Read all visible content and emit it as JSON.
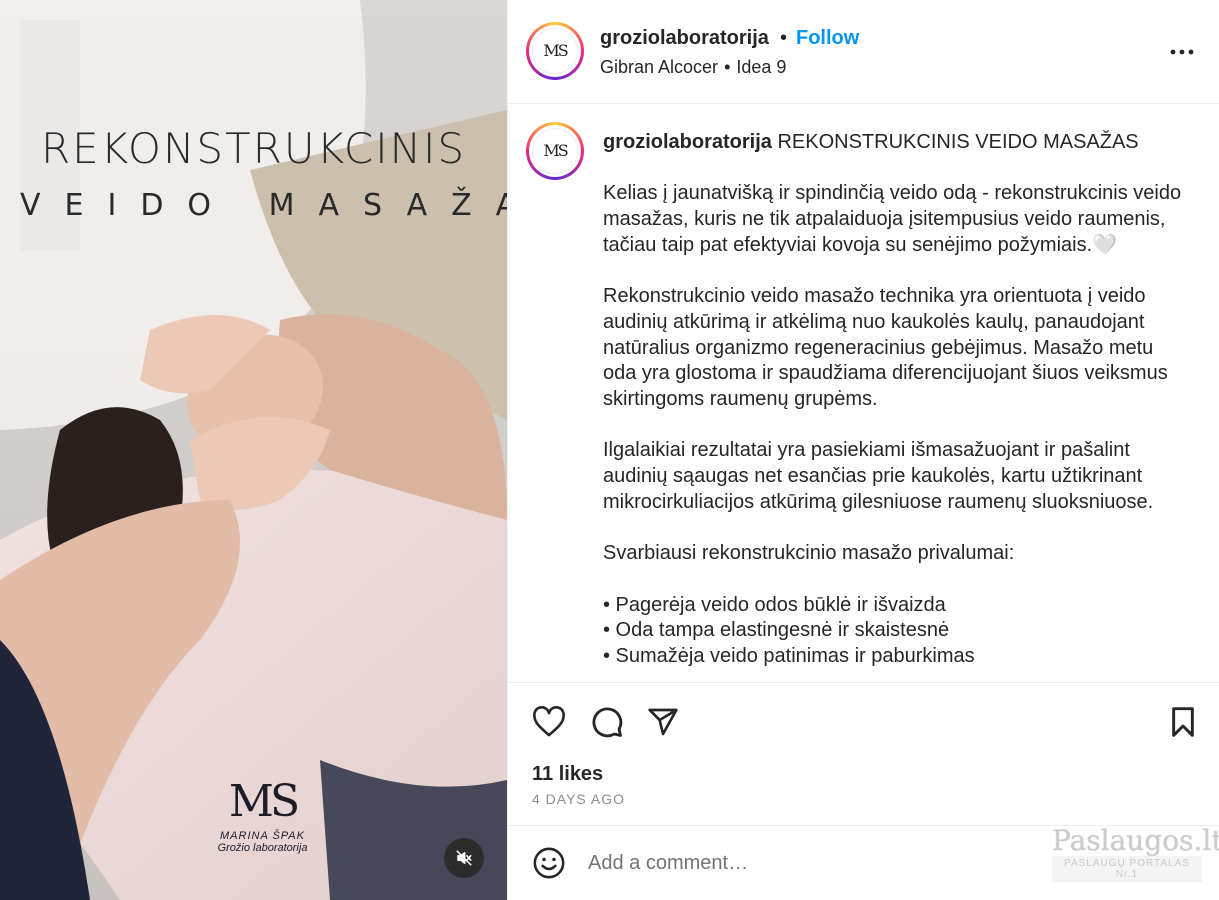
{
  "media": {
    "title_line1": "REKONSTRUKCINIS",
    "title_line2": "VEIDO MASAŽAS",
    "logo_mark": "MS",
    "logo_name": "MARINA ŠPAK",
    "logo_sub": "Grožio laboratorija"
  },
  "header": {
    "username": "groziolaboratorija",
    "dot": "•",
    "follow_label": "Follow",
    "audio_artist": "Gibran Alcocer",
    "audio_sep": "•",
    "audio_track": "Idea 9"
  },
  "caption": {
    "username": "groziolaboratorija",
    "headline": "REKONSTRUKCINIS VEIDO MASAŽAS",
    "paragraphs": [
      "Kelias į jaunatvišką ir spindinčią veido odą - rekonstrukcinis veido masažas, kuris ne tik atpalaiduoja įsitempusius veido raumenis, tačiau taip pat efektyviai kovoja su senėjimo požymiais.🤍",
      "Rekonstrukcinio veido masažo technika yra orientuota į veido audinių atkūrimą ir atkėlimą nuo kaukolės kaulų, panaudojant natūralius organizmo regeneracinius gebėjimus. Masažo metu oda yra glostoma ir spaudžiama diferencijuojant šiuos veiksmus skirtingoms raumenų grupėms.",
      "Ilgalaikiai rezultatai yra pasiekiami išmasažuojant ir pašalint audinių sąaugas net esančias prie kaukolės, kartu užtikrinant mikrocirkuliacijos atkūrimą gilesniuose raumenų sluoksniuose.",
      "Svarbiausi rekonstrukcinio masažo privalumai:"
    ],
    "bullets": [
      "• Pagerėja veido odos būklė ir išvaizda",
      "• Oda tampa elastingesnė ir skaistesnė",
      "• Sumažėja veido patinimas ir paburkimas"
    ]
  },
  "actions": {
    "likes": "11 likes",
    "time_ago": "4 DAYS AGO"
  },
  "comment": {
    "placeholder": "Add a comment…"
  },
  "watermark": {
    "brand": "Paslaugos.lt",
    "tagline": "PASLAUGŲ PORTALAS Nr.1"
  },
  "colors": {
    "accent": "#0095f6",
    "text": "#262626",
    "muted": "#8e8e8e",
    "border": "#efefef"
  },
  "icons": [
    "more-icon",
    "heart-icon",
    "comment-icon",
    "share-icon",
    "bookmark-icon",
    "emoji-icon",
    "mute-icon"
  ]
}
